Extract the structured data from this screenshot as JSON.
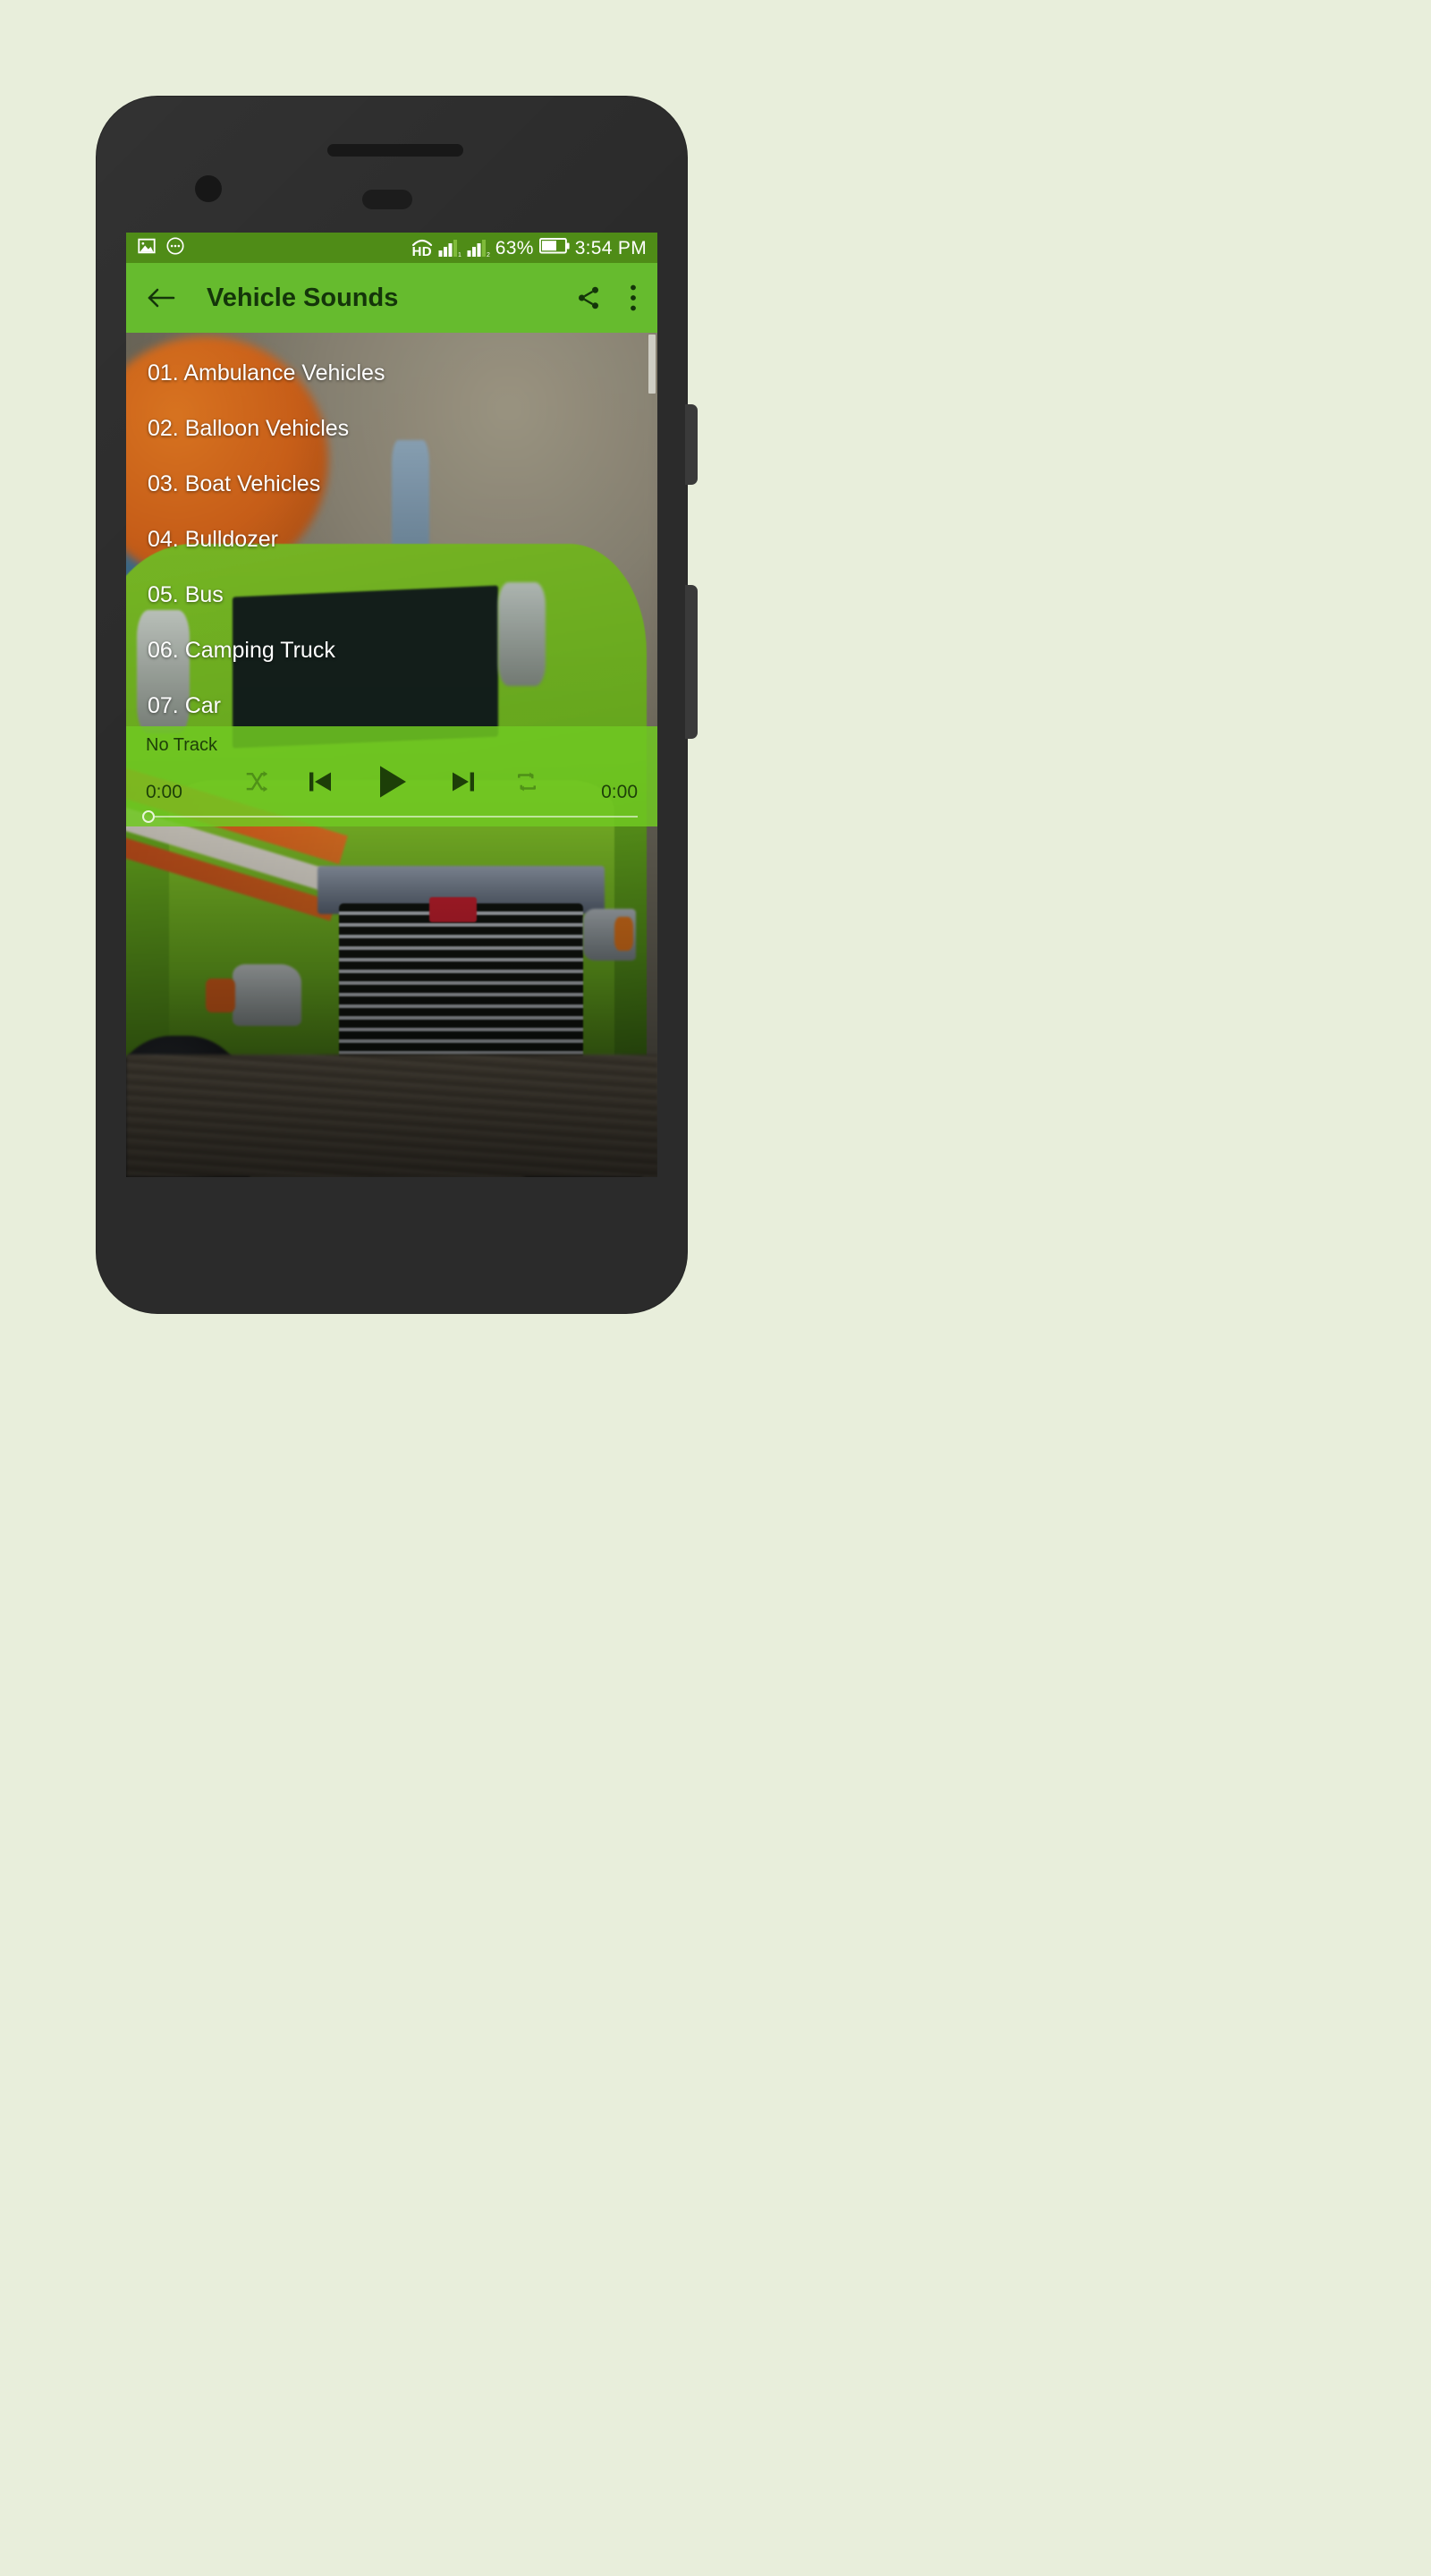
{
  "device": {
    "frame_color": "#2b2b2b",
    "camera_icon": "camera-dot",
    "speaker_icon": "earpiece-speaker",
    "sensor_icon": "proximity-sensor"
  },
  "status_bar": {
    "background": "#4f8c17",
    "left_icons": [
      "image-icon",
      "more-circle-icon"
    ],
    "network_label": "HD",
    "signal_labels": [
      "1",
      "2"
    ],
    "battery_percent": "63%",
    "battery_icon": "battery-icon",
    "time": "3:54 PM"
  },
  "app_bar": {
    "background": "#66bb2e",
    "back_icon": "back-arrow-icon",
    "title": "Vehicle Sounds",
    "share_icon": "share-icon",
    "overflow_icon": "overflow-menu-icon"
  },
  "list": {
    "items": [
      {
        "label": "01. Ambulance Vehicles"
      },
      {
        "label": "02. Balloon Vehicles"
      },
      {
        "label": "03. Boat Vehicles"
      },
      {
        "label": "04. Bulldozer"
      },
      {
        "label": "05. Bus"
      },
      {
        "label": "06. Camping Truck"
      },
      {
        "label": "07. Car"
      }
    ]
  },
  "player": {
    "background": "#70c822",
    "track_title": "No Track",
    "shuffle_icon": "shuffle-icon",
    "previous_icon": "previous-track-icon",
    "play_icon": "play-icon",
    "next_icon": "next-track-icon",
    "repeat_icon": "repeat-icon",
    "elapsed_time": "0:00",
    "total_time": "0:00",
    "seek_position_percent": 0
  }
}
